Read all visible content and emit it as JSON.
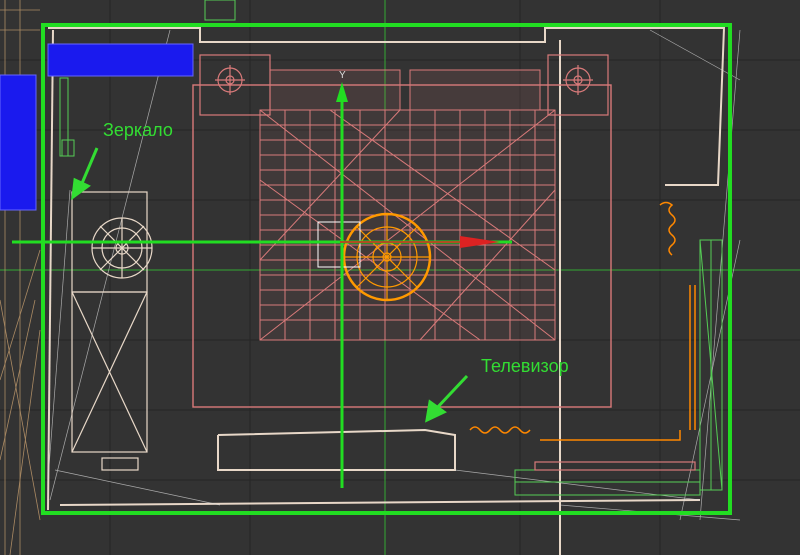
{
  "viewport": {
    "background": "#333333",
    "grid_color": "#222222",
    "geometry_color": "#d97a7a",
    "frame_color": "#22dd22",
    "orange_color": "#ff8800",
    "blue_color": "#1a1aee"
  },
  "annotations": {
    "mirror": "Зеркало",
    "tv": "Телевизор"
  },
  "axis": {
    "y_label": "Y"
  }
}
